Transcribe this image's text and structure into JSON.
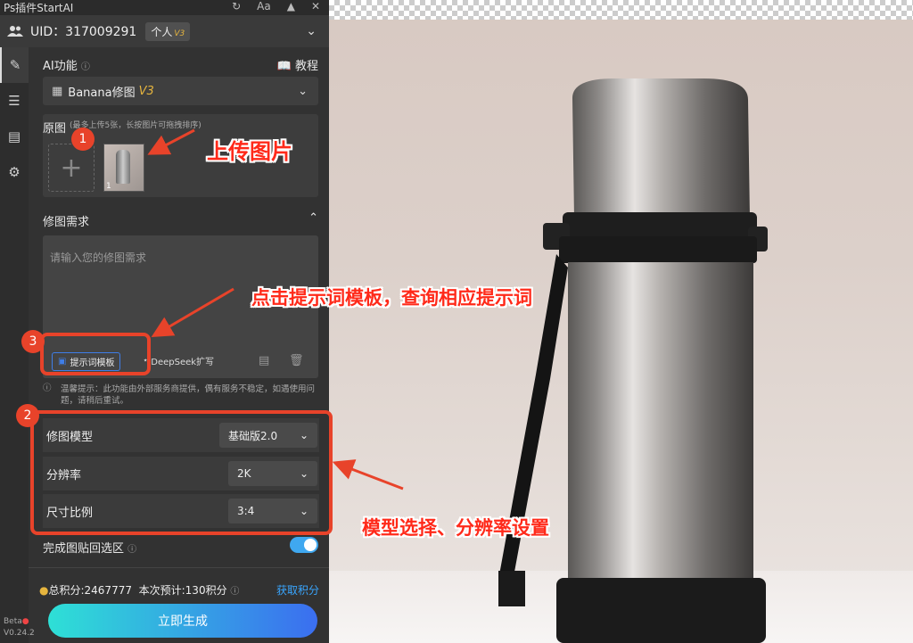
{
  "window": {
    "title": "Ps插件StartAI",
    "controls": [
      "↻",
      "Aa",
      "📌",
      "✕"
    ]
  },
  "account": {
    "uid_text": "UID：317009291",
    "plan_label": "个人",
    "plan_version": "V3"
  },
  "ai_function": {
    "label": "AI功能",
    "tutorial_label": "教程",
    "selected_tool": "Banana修图",
    "tool_version": "V3"
  },
  "source_images": {
    "label": "原图",
    "hint": "(最多上传5张，长按图片可拖拽排序)",
    "thumb_index": "1"
  },
  "requirement": {
    "label": "修图需求",
    "placeholder": "请输入您的修图需求",
    "template_button": "提示词模板",
    "deepseek_button": "DeepSeek扩写",
    "tip": "温馨提示：此功能由外部服务商提供，偶有服务不稳定，如遇使用问题，请稍后重试。"
  },
  "options": [
    {
      "label": "修图模型",
      "value": "基础版2.0"
    },
    {
      "label": "分辨率",
      "value": "2K"
    },
    {
      "label": "尺寸比例",
      "value": "3:4"
    }
  ],
  "paste_back": {
    "label": "完成图贴回选区",
    "enabled": true
  },
  "credits": {
    "total_text": "总积分:2467777",
    "estimate_text": "本次预计:130积分",
    "earn_label": "获取积分"
  },
  "generate_button": "立即生成",
  "version": {
    "beta": "Beta",
    "number": "V0.24.2"
  },
  "annotations": {
    "n1": "1",
    "n2": "2",
    "n3": "3",
    "upload_text": "上传图片",
    "template_text": "点击提示词模板，查询相应提示词",
    "model_text": "模型选择、分辨率设置"
  },
  "colors": {
    "annotation_red": "#e8432a",
    "accent_blue": "#3fa8f0",
    "gradient_start": "#2ee0d6",
    "gradient_end": "#3b6ef0"
  }
}
